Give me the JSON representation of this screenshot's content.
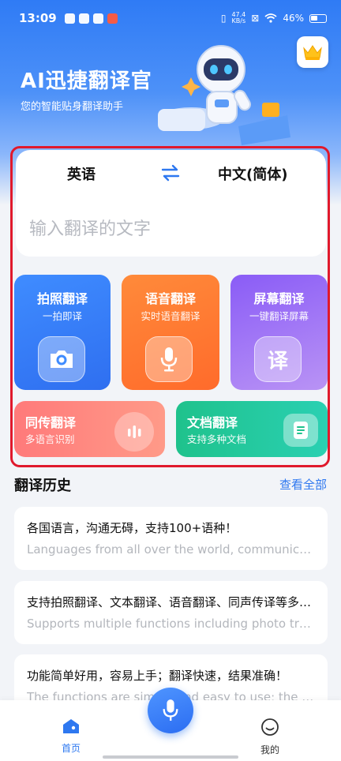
{
  "status": {
    "time": "13:09",
    "net_speed_value": "47.4",
    "net_speed_unit": "KB/s",
    "battery": "46%"
  },
  "header": {
    "title": "AI迅捷翻译官",
    "subtitle": "您的智能贴身翻译助手"
  },
  "translator": {
    "source_lang": "英语",
    "target_lang": "中文(简体)",
    "input_placeholder": "输入翻译的文字"
  },
  "features": {
    "photo": {
      "title": "拍照翻译",
      "sub": "一拍即译"
    },
    "voice": {
      "title": "语音翻译",
      "sub": "实时语音翻译"
    },
    "screen": {
      "title": "屏幕翻译",
      "sub": "一键翻译屏幕",
      "icon_char": "译"
    },
    "simul": {
      "title": "同传翻译",
      "sub": "多语言识别"
    },
    "doc": {
      "title": "文档翻译",
      "sub": "支持多种文档"
    }
  },
  "history": {
    "title": "翻译历史",
    "view_all": "查看全部",
    "items": [
      {
        "main": "各国语言，沟通无碍，支持100+语种！",
        "en": "Languages from all over the world, communication without obstacles"
      },
      {
        "main": "支持拍照翻译、文本翻译、语音翻译、同声传译等多种功能",
        "en": "Supports multiple functions including photo translation"
      },
      {
        "main": "功能简单好用，容易上手；翻译快速，结果准确！",
        "en": "The functions are simple and easy to use; the translation is fast"
      }
    ]
  },
  "nav": {
    "home": "首页",
    "mine": "我的"
  },
  "colors": {
    "accent": "#2e78f0",
    "highlight_frame": "#e0192c"
  },
  "icons": [
    "crown-icon",
    "swap-icon",
    "camera-icon",
    "microphone-icon",
    "waveform-icon",
    "document-icon",
    "home-icon",
    "smiley-icon"
  ]
}
